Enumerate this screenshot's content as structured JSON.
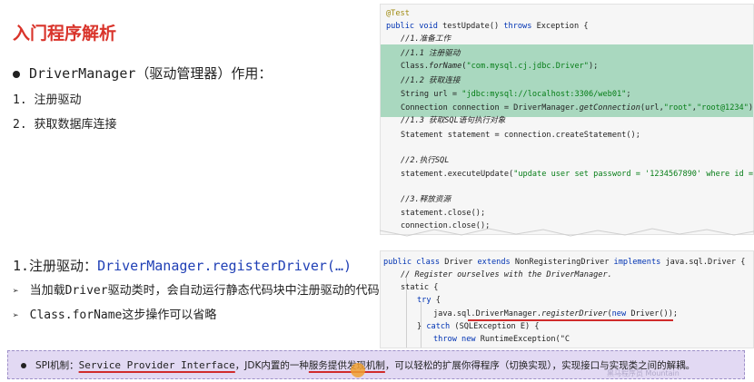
{
  "title": "入门程序解析",
  "intro": {
    "bullet": "DriverManager（驱动管理器）作用：",
    "items": [
      "1. 注册驱动",
      "2. 获取数据库连接"
    ]
  },
  "code1": {
    "l1": "@Test",
    "l2a": "public void ",
    "l2b": "testUpdate() ",
    "l2c": "throws ",
    "l2d": "Exception {",
    "l3": "//1.准备工作",
    "l4": "//1.1 注册驱动",
    "l5a": "Class.",
    "l5b": "forName",
    "l5c": "(",
    "l5d": "\"com.mysql.cj.jdbc.Driver\"",
    "l5e": ");",
    "l6": "//1.2 获取连接",
    "l7a": "String url = ",
    "l7b": "\"jdbc:mysql://localhost:3306/web01\"",
    "l7c": ";",
    "l8a": "Connection connection = DriverManager.",
    "l8b": "getConnection",
    "l8c": "(url,",
    "l8d": "\"root\"",
    "l8e": ",",
    "l8f": "\"root@1234\"",
    "l8g": ");",
    "l9": "//1.3 获取SQL语句执行对象",
    "l10": "Statement statement = connection.createStatement();",
    "l11": "//2.执行SQL",
    "l12a": "statement.executeUpdate(",
    "l12b": "\"update user set password = '1234567890' where id = 1\"",
    "l12c": ");",
    "l13": "//3.释放资源",
    "l14": "statement.close();",
    "l15": "connection.close();"
  },
  "section2": {
    "heading_prefix": "1.注册驱动：",
    "heading_code": "DriverManager.registerDriver(…)",
    "items": [
      "当加载Driver驱动类时，会自动运行静态代码块中注册驱动的代码",
      "Class.forName这步操作可以省略"
    ]
  },
  "code2": {
    "l1a": "public class ",
    "l1b": "Driver ",
    "l1c": "extends ",
    "l1d": "NonRegisteringDriver ",
    "l1e": "implements ",
    "l1f": "java.sql.Driver {",
    "l2": "// Register ourselves with the DriverManager.",
    "l3": "static {",
    "l4a": "try",
    "l4b": " {",
    "l5a": "java.sql.DriverManager.",
    "l5b": "registerDriver",
    "l5c": "(",
    "l5d": "new ",
    "l5e": "Driver());",
    "l6a": "} ",
    "l6b": "catch ",
    "l6c": "(SQLException E) {",
    "l7a": "throw new ",
    "l7b": "RuntimeException(\"C"
  },
  "spi": {
    "prefix": "SPI机制：",
    "name": "Service Provider Interface",
    "mid": "，JDK内置的一种",
    "highlight": "服务提供发现机制",
    "suffix": "，可以轻松的扩展你得程序（切换实现），实现接口与实现类之间的解耦。"
  },
  "watermark": "黑马程序员 Mountain"
}
